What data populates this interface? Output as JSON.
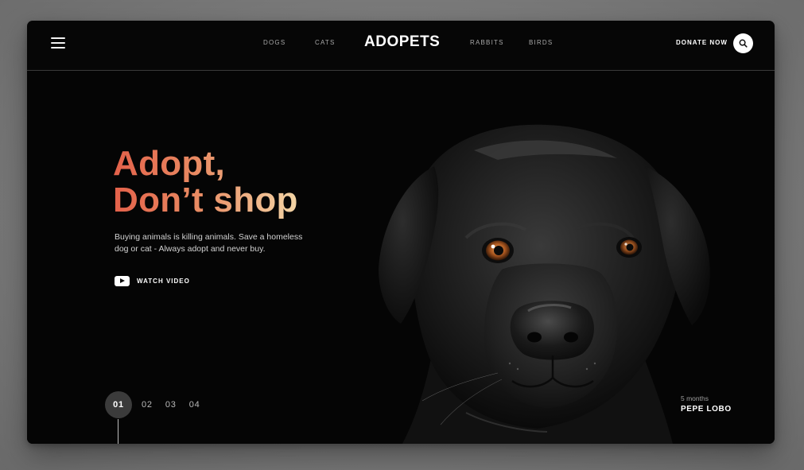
{
  "header": {
    "nav_left": [
      "DOGS",
      "CATS"
    ],
    "brand": "ADOPETS",
    "nav_right": [
      "RABBITS",
      "BIRDS"
    ],
    "donate_label": "DONATE NOW"
  },
  "hero": {
    "headline_line1": "Adopt,",
    "headline_line2": "Don’t shop",
    "description": "Buying animals is killing animals. Save a homeless dog or cat - Always adopt and never buy.",
    "watch_video_label": "WATCH VIDEO",
    "headline_gradient": [
      "#e3614a",
      "#f3d5a6"
    ]
  },
  "pagination": {
    "items": [
      "01",
      "02",
      "03",
      "04"
    ],
    "active": "01"
  },
  "pet": {
    "age": "5 months",
    "name": "PEPE LOBO"
  },
  "icons": {
    "menu": "hamburger-icon",
    "search": "search-icon",
    "play": "play-icon"
  }
}
